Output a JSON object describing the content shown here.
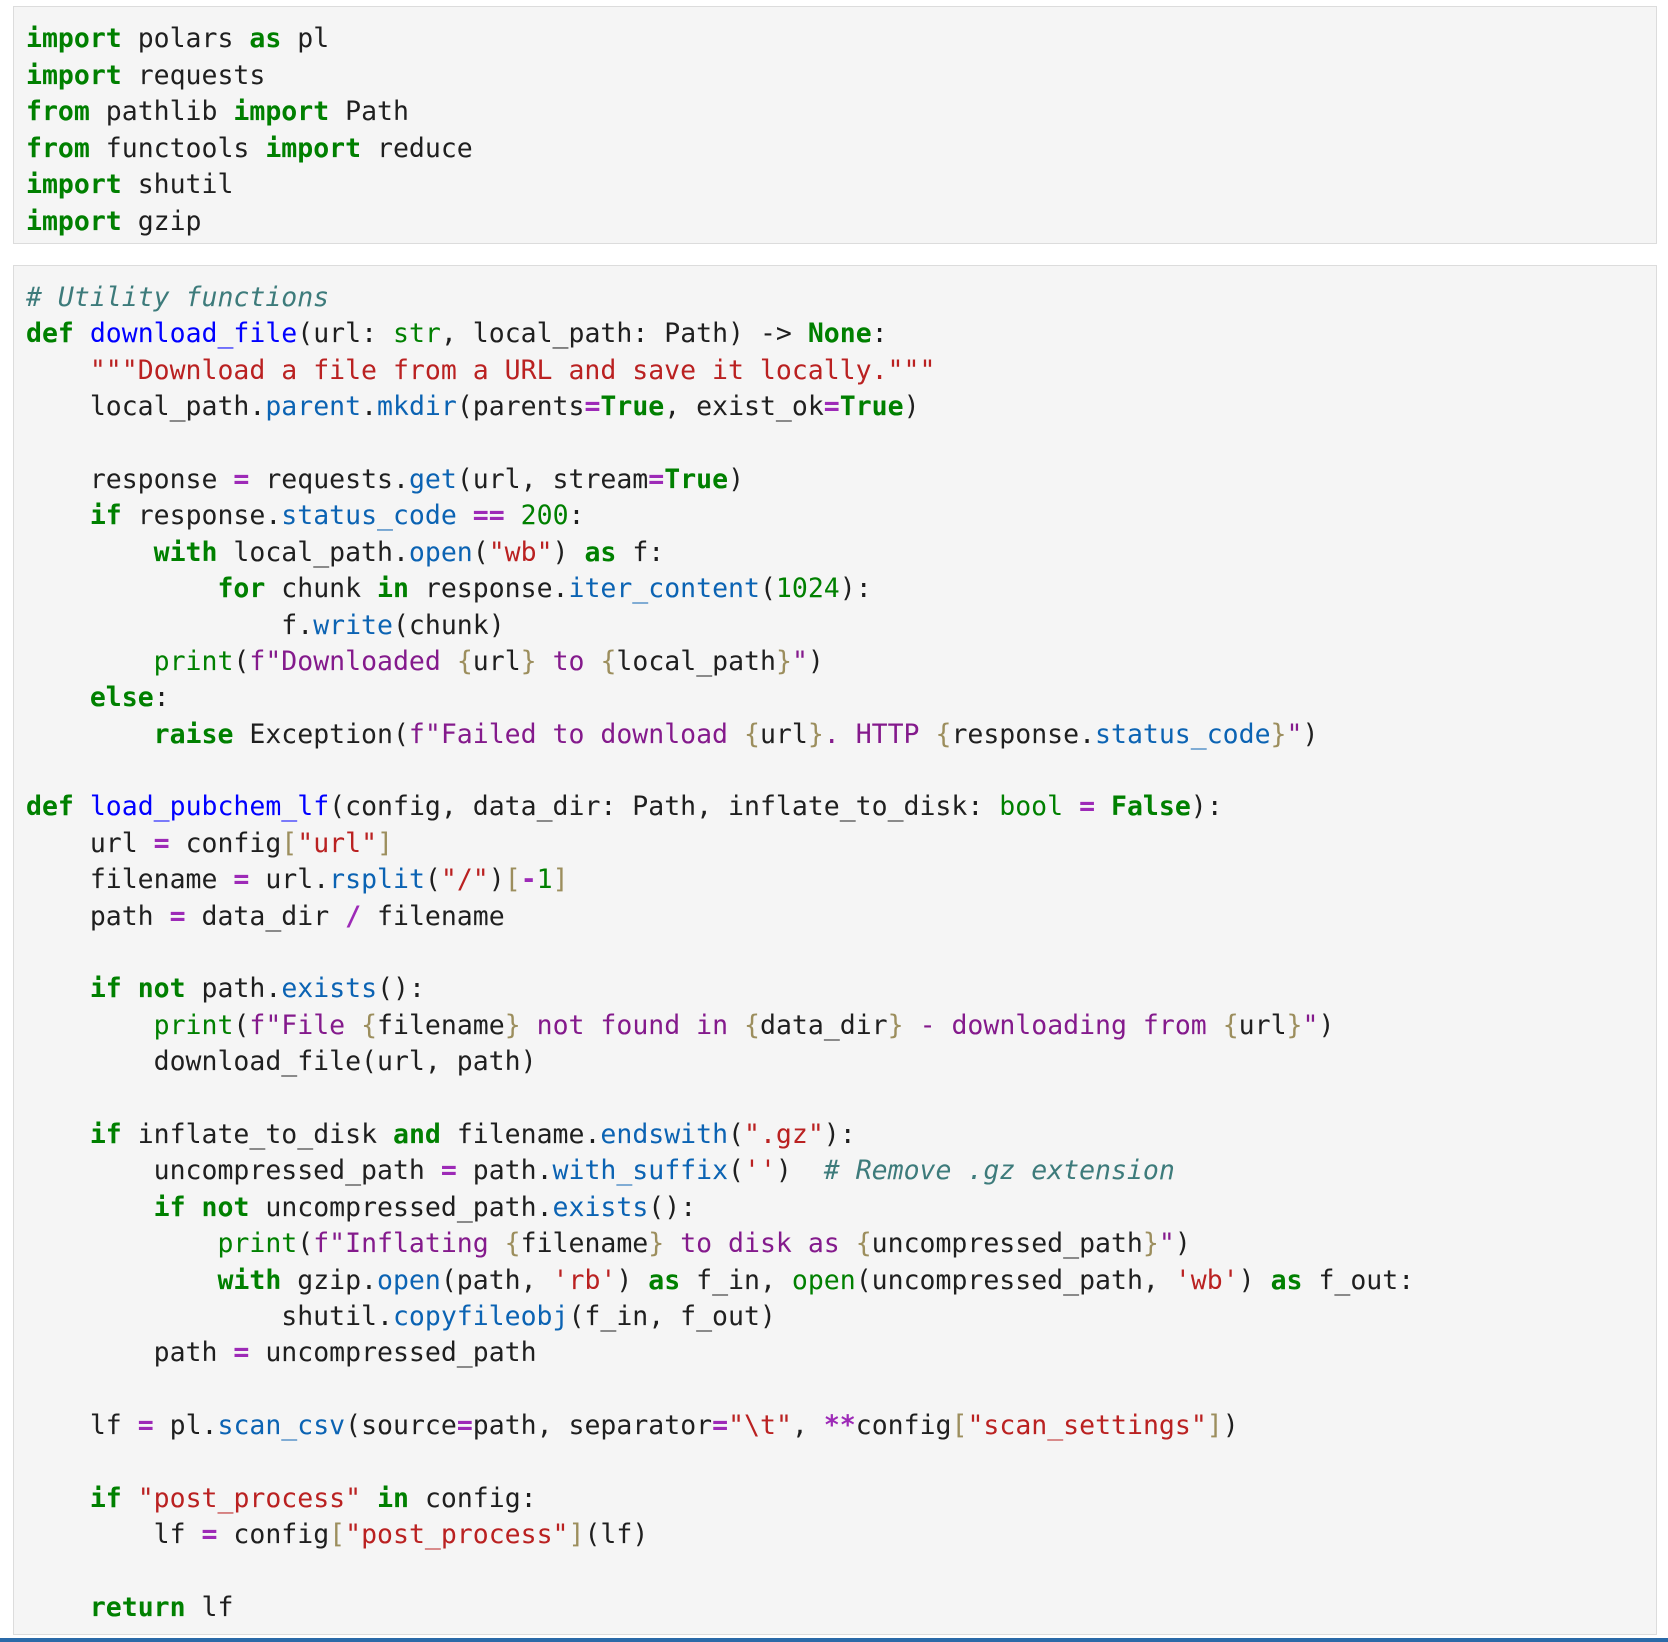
{
  "colors": {
    "keyword": "#008000",
    "function_name": "#0000ff",
    "attribute": "#0b63b3",
    "string": "#ba2121",
    "fstring": "#841a8c",
    "interpolation_brace": "#9c8e5d",
    "number": "#008000",
    "operator": "#9d2ab7",
    "comment": "#3d7b7b",
    "cell_background": "#f5f5f5",
    "cell_border": "#dcdcdc",
    "focus_bar": "#2a6aa8"
  },
  "cells": [
    {
      "lines": [
        [
          [
            "kw",
            "import"
          ],
          [
            "t",
            " polars "
          ],
          [
            "kw",
            "as"
          ],
          [
            "t",
            " pl"
          ]
        ],
        [
          [
            "kw",
            "import"
          ],
          [
            "t",
            " requests"
          ]
        ],
        [
          [
            "kw",
            "from"
          ],
          [
            "t",
            " pathlib "
          ],
          [
            "kw",
            "import"
          ],
          [
            "t",
            " Path"
          ]
        ],
        [
          [
            "kw",
            "from"
          ],
          [
            "t",
            " functools "
          ],
          [
            "kw",
            "import"
          ],
          [
            "t",
            " reduce"
          ]
        ],
        [
          [
            "kw",
            "import"
          ],
          [
            "t",
            " shutil"
          ]
        ],
        [
          [
            "kw",
            "import"
          ],
          [
            "t",
            " gzip"
          ]
        ]
      ]
    },
    {
      "lines": [
        [
          [
            "comment",
            "# Utility functions"
          ]
        ],
        [
          [
            "kw",
            "def"
          ],
          [
            "t",
            " "
          ],
          [
            "fn",
            "download_file"
          ],
          [
            "t",
            "(url: "
          ],
          [
            "builtin",
            "str"
          ],
          [
            "t",
            ", local_path: Path) -> "
          ],
          [
            "kw",
            "None"
          ],
          [
            "t",
            ":"
          ]
        ],
        [
          [
            "t",
            "    "
          ],
          [
            "str",
            "\"\"\"Download a file from a URL and save it locally.\"\"\""
          ]
        ],
        [
          [
            "t",
            "    local_path."
          ],
          [
            "attr",
            "parent"
          ],
          [
            "t",
            "."
          ],
          [
            "attr",
            "mkdir"
          ],
          [
            "t",
            "(parents"
          ],
          [
            "op",
            "="
          ],
          [
            "kw",
            "True"
          ],
          [
            "t",
            ", exist_ok"
          ],
          [
            "op",
            "="
          ],
          [
            "kw",
            "True"
          ],
          [
            "t",
            ")"
          ]
        ],
        [],
        [
          [
            "t",
            "    response "
          ],
          [
            "op",
            "="
          ],
          [
            "t",
            " requests."
          ],
          [
            "attr",
            "get"
          ],
          [
            "t",
            "(url, stream"
          ],
          [
            "op",
            "="
          ],
          [
            "kw",
            "True"
          ],
          [
            "t",
            ")"
          ]
        ],
        [
          [
            "t",
            "    "
          ],
          [
            "kw",
            "if"
          ],
          [
            "t",
            " response."
          ],
          [
            "attr",
            "status_code"
          ],
          [
            "t",
            " "
          ],
          [
            "op",
            "=="
          ],
          [
            "t",
            " "
          ],
          [
            "num",
            "200"
          ],
          [
            "t",
            ":"
          ]
        ],
        [
          [
            "t",
            "        "
          ],
          [
            "kw",
            "with"
          ],
          [
            "t",
            " local_path."
          ],
          [
            "attr",
            "open"
          ],
          [
            "t",
            "("
          ],
          [
            "str",
            "\"wb\""
          ],
          [
            "t",
            ") "
          ],
          [
            "kw",
            "as"
          ],
          [
            "t",
            " f:"
          ]
        ],
        [
          [
            "t",
            "            "
          ],
          [
            "kw",
            "for"
          ],
          [
            "t",
            " chunk "
          ],
          [
            "kw",
            "in"
          ],
          [
            "t",
            " response."
          ],
          [
            "attr",
            "iter_content"
          ],
          [
            "t",
            "("
          ],
          [
            "num",
            "1024"
          ],
          [
            "t",
            "):"
          ]
        ],
        [
          [
            "t",
            "                f."
          ],
          [
            "attr",
            "write"
          ],
          [
            "t",
            "(chunk)"
          ]
        ],
        [
          [
            "t",
            "        "
          ],
          [
            "builtin",
            "print"
          ],
          [
            "t",
            "("
          ],
          [
            "fstr",
            "f\"Downloaded "
          ],
          [
            "interp",
            "{"
          ],
          [
            "t",
            "url"
          ],
          [
            "interp",
            "}"
          ],
          [
            "fstr",
            " to "
          ],
          [
            "interp",
            "{"
          ],
          [
            "t",
            "local_path"
          ],
          [
            "interp",
            "}"
          ],
          [
            "fstr",
            "\""
          ],
          [
            "t",
            ")"
          ]
        ],
        [
          [
            "t",
            "    "
          ],
          [
            "kw",
            "else"
          ],
          [
            "t",
            ":"
          ]
        ],
        [
          [
            "t",
            "        "
          ],
          [
            "kw",
            "raise"
          ],
          [
            "t",
            " Exception("
          ],
          [
            "fstr",
            "f\"Failed to download "
          ],
          [
            "interp",
            "{"
          ],
          [
            "t",
            "url"
          ],
          [
            "interp",
            "}"
          ],
          [
            "fstr",
            ". HTTP "
          ],
          [
            "interp",
            "{"
          ],
          [
            "t",
            "response."
          ],
          [
            "attr",
            "status_code"
          ],
          [
            "interp",
            "}"
          ],
          [
            "fstr",
            "\""
          ],
          [
            "t",
            ")"
          ]
        ],
        [],
        [
          [
            "kw",
            "def"
          ],
          [
            "t",
            " "
          ],
          [
            "fn",
            "load_pubchem_lf"
          ],
          [
            "t",
            "(config, data_dir: Path, inflate_to_disk: "
          ],
          [
            "builtin",
            "bool"
          ],
          [
            "t",
            " "
          ],
          [
            "op",
            "="
          ],
          [
            "t",
            " "
          ],
          [
            "kw",
            "False"
          ],
          [
            "t",
            "):"
          ]
        ],
        [
          [
            "t",
            "    url "
          ],
          [
            "op",
            "="
          ],
          [
            "t",
            " config"
          ],
          [
            "bracket",
            "["
          ],
          [
            "str",
            "\"url\""
          ],
          [
            "bracket",
            "]"
          ]
        ],
        [
          [
            "t",
            "    filename "
          ],
          [
            "op",
            "="
          ],
          [
            "t",
            " url."
          ],
          [
            "attr",
            "rsplit"
          ],
          [
            "t",
            "("
          ],
          [
            "str",
            "\"/\""
          ],
          [
            "t",
            ")"
          ],
          [
            "bracket",
            "["
          ],
          [
            "op",
            "-"
          ],
          [
            "num",
            "1"
          ],
          [
            "bracket",
            "]"
          ]
        ],
        [
          [
            "t",
            "    path "
          ],
          [
            "op",
            "="
          ],
          [
            "t",
            " data_dir "
          ],
          [
            "op",
            "/"
          ],
          [
            "t",
            " filename"
          ]
        ],
        [],
        [
          [
            "t",
            "    "
          ],
          [
            "kw",
            "if"
          ],
          [
            "t",
            " "
          ],
          [
            "kw",
            "not"
          ],
          [
            "t",
            " path."
          ],
          [
            "attr",
            "exists"
          ],
          [
            "t",
            "():"
          ]
        ],
        [
          [
            "t",
            "        "
          ],
          [
            "builtin",
            "print"
          ],
          [
            "t",
            "("
          ],
          [
            "fstr",
            "f\"File "
          ],
          [
            "interp",
            "{"
          ],
          [
            "t",
            "filename"
          ],
          [
            "interp",
            "}"
          ],
          [
            "fstr",
            " not found in "
          ],
          [
            "interp",
            "{"
          ],
          [
            "t",
            "data_dir"
          ],
          [
            "interp",
            "}"
          ],
          [
            "fstr",
            " - downloading from "
          ],
          [
            "interp",
            "{"
          ],
          [
            "t",
            "url"
          ],
          [
            "interp",
            "}"
          ],
          [
            "fstr",
            "\""
          ],
          [
            "t",
            ")"
          ]
        ],
        [
          [
            "t",
            "        download_file(url, path)"
          ]
        ],
        [],
        [
          [
            "t",
            "    "
          ],
          [
            "kw",
            "if"
          ],
          [
            "t",
            " inflate_to_disk "
          ],
          [
            "kw",
            "and"
          ],
          [
            "t",
            " filename."
          ],
          [
            "attr",
            "endswith"
          ],
          [
            "t",
            "("
          ],
          [
            "str",
            "\".gz\""
          ],
          [
            "t",
            "):"
          ]
        ],
        [
          [
            "t",
            "        uncompressed_path "
          ],
          [
            "op",
            "="
          ],
          [
            "t",
            " path."
          ],
          [
            "attr",
            "with_suffix"
          ],
          [
            "t",
            "("
          ],
          [
            "str",
            "''"
          ],
          [
            "t",
            ")  "
          ],
          [
            "comment",
            "# Remove .gz extension"
          ]
        ],
        [
          [
            "t",
            "        "
          ],
          [
            "kw",
            "if"
          ],
          [
            "t",
            " "
          ],
          [
            "kw",
            "not"
          ],
          [
            "t",
            " uncompressed_path."
          ],
          [
            "attr",
            "exists"
          ],
          [
            "t",
            "():"
          ]
        ],
        [
          [
            "t",
            "            "
          ],
          [
            "builtin",
            "print"
          ],
          [
            "t",
            "("
          ],
          [
            "fstr",
            "f\"Inflating "
          ],
          [
            "interp",
            "{"
          ],
          [
            "t",
            "filename"
          ],
          [
            "interp",
            "}"
          ],
          [
            "fstr",
            " to disk as "
          ],
          [
            "interp",
            "{"
          ],
          [
            "t",
            "uncompressed_path"
          ],
          [
            "interp",
            "}"
          ],
          [
            "fstr",
            "\""
          ],
          [
            "t",
            ")"
          ]
        ],
        [
          [
            "t",
            "            "
          ],
          [
            "kw",
            "with"
          ],
          [
            "t",
            " gzip."
          ],
          [
            "attr",
            "open"
          ],
          [
            "t",
            "(path, "
          ],
          [
            "str",
            "'rb'"
          ],
          [
            "t",
            ") "
          ],
          [
            "kw",
            "as"
          ],
          [
            "t",
            " f_in, "
          ],
          [
            "builtin",
            "open"
          ],
          [
            "t",
            "(uncompressed_path, "
          ],
          [
            "str",
            "'wb'"
          ],
          [
            "t",
            ") "
          ],
          [
            "kw",
            "as"
          ],
          [
            "t",
            " f_out:"
          ]
        ],
        [
          [
            "t",
            "                shutil."
          ],
          [
            "attr",
            "copyfileobj"
          ],
          [
            "t",
            "(f_in, f_out)"
          ]
        ],
        [
          [
            "t",
            "        path "
          ],
          [
            "op",
            "="
          ],
          [
            "t",
            " uncompressed_path"
          ]
        ],
        [],
        [
          [
            "t",
            "    lf "
          ],
          [
            "op",
            "="
          ],
          [
            "t",
            " pl."
          ],
          [
            "attr",
            "scan_csv"
          ],
          [
            "t",
            "(source"
          ],
          [
            "op",
            "="
          ],
          [
            "t",
            "path, separator"
          ],
          [
            "op",
            "="
          ],
          [
            "str",
            "\"\\t\""
          ],
          [
            "t",
            ", "
          ],
          [
            "op",
            "**"
          ],
          [
            "t",
            "config"
          ],
          [
            "bracket",
            "["
          ],
          [
            "str",
            "\"scan_settings\""
          ],
          [
            "bracket",
            "]"
          ],
          [
            "t",
            ")"
          ]
        ],
        [],
        [
          [
            "t",
            "    "
          ],
          [
            "kw",
            "if"
          ],
          [
            "t",
            " "
          ],
          [
            "str",
            "\"post_process\""
          ],
          [
            "t",
            " "
          ],
          [
            "kw",
            "in"
          ],
          [
            "t",
            " config:"
          ]
        ],
        [
          [
            "t",
            "        lf "
          ],
          [
            "op",
            "="
          ],
          [
            "t",
            " config"
          ],
          [
            "bracket",
            "["
          ],
          [
            "str",
            "\"post_process\""
          ],
          [
            "bracket",
            "]"
          ],
          [
            "t",
            "(lf)"
          ]
        ],
        [],
        [
          [
            "t",
            "    "
          ],
          [
            "kw",
            "return"
          ],
          [
            "t",
            " lf"
          ]
        ]
      ]
    }
  ]
}
